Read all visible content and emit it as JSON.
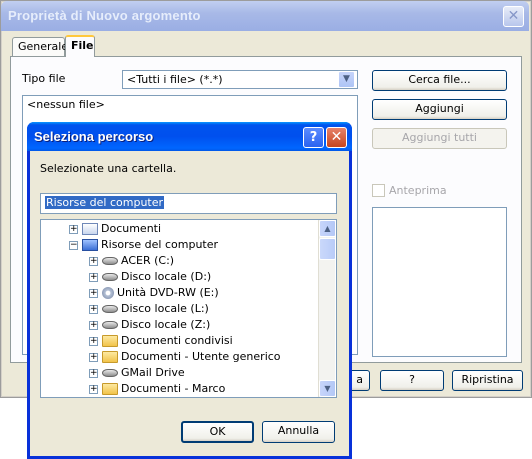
{
  "main_window": {
    "title": "Proprietà di  Nuovo argomento",
    "close_glyph": "✕",
    "tabs": [
      {
        "label": "Generale",
        "active": false
      },
      {
        "label": "File",
        "active": true
      }
    ],
    "file_type": {
      "label": "Tipo file",
      "value": "<Tutti i file> (*.*)",
      "arrow_glyph": "▼"
    },
    "file_list_text": "<nessun file>",
    "buttons": {
      "cerca": "Cerca file...",
      "aggiungi": "Aggiungi",
      "aggiungi_tutti": "Aggiungi tutti",
      "partial": "a",
      "help": "?",
      "ripristina": "Ripristina"
    },
    "preview_label": "Anteprima"
  },
  "folder_dialog": {
    "title": "Seleziona percorso",
    "help_glyph": "?",
    "close_glyph": "✕",
    "instruction": "Selezionate una cartella.",
    "path_value": "Risorse del computer",
    "tree": [
      {
        "label": "Documenti",
        "icon": "documents-icon",
        "level": 1,
        "expander": "+"
      },
      {
        "label": "Risorse del computer",
        "icon": "computer-icon",
        "level": 1,
        "expander": "−"
      },
      {
        "label": "ACER (C:)",
        "icon": "drive-icon",
        "level": 2,
        "expander": "+"
      },
      {
        "label": "Disco locale (D:)",
        "icon": "drive-icon",
        "level": 2,
        "expander": "+"
      },
      {
        "label": "Unità DVD-RW (E:)",
        "icon": "cd-drive-icon",
        "level": 2,
        "expander": "+"
      },
      {
        "label": "Disco locale (L:)",
        "icon": "drive-icon",
        "level": 2,
        "expander": "+"
      },
      {
        "label": "Disco locale (Z:)",
        "icon": "drive-icon",
        "level": 2,
        "expander": "+"
      },
      {
        "label": "Documenti condivisi",
        "icon": "folder-icon",
        "level": 2,
        "expander": "+"
      },
      {
        "label": "Documenti - Utente generico",
        "icon": "folder-icon",
        "level": 2,
        "expander": "+"
      },
      {
        "label": "GMail Drive",
        "icon": "drive-icon",
        "level": 2,
        "expander": "+"
      },
      {
        "label": "Documenti - Marco",
        "icon": "folder-icon",
        "level": 2,
        "expander": "+"
      }
    ],
    "ok_label": "OK",
    "cancel_label": "Annulla"
  }
}
